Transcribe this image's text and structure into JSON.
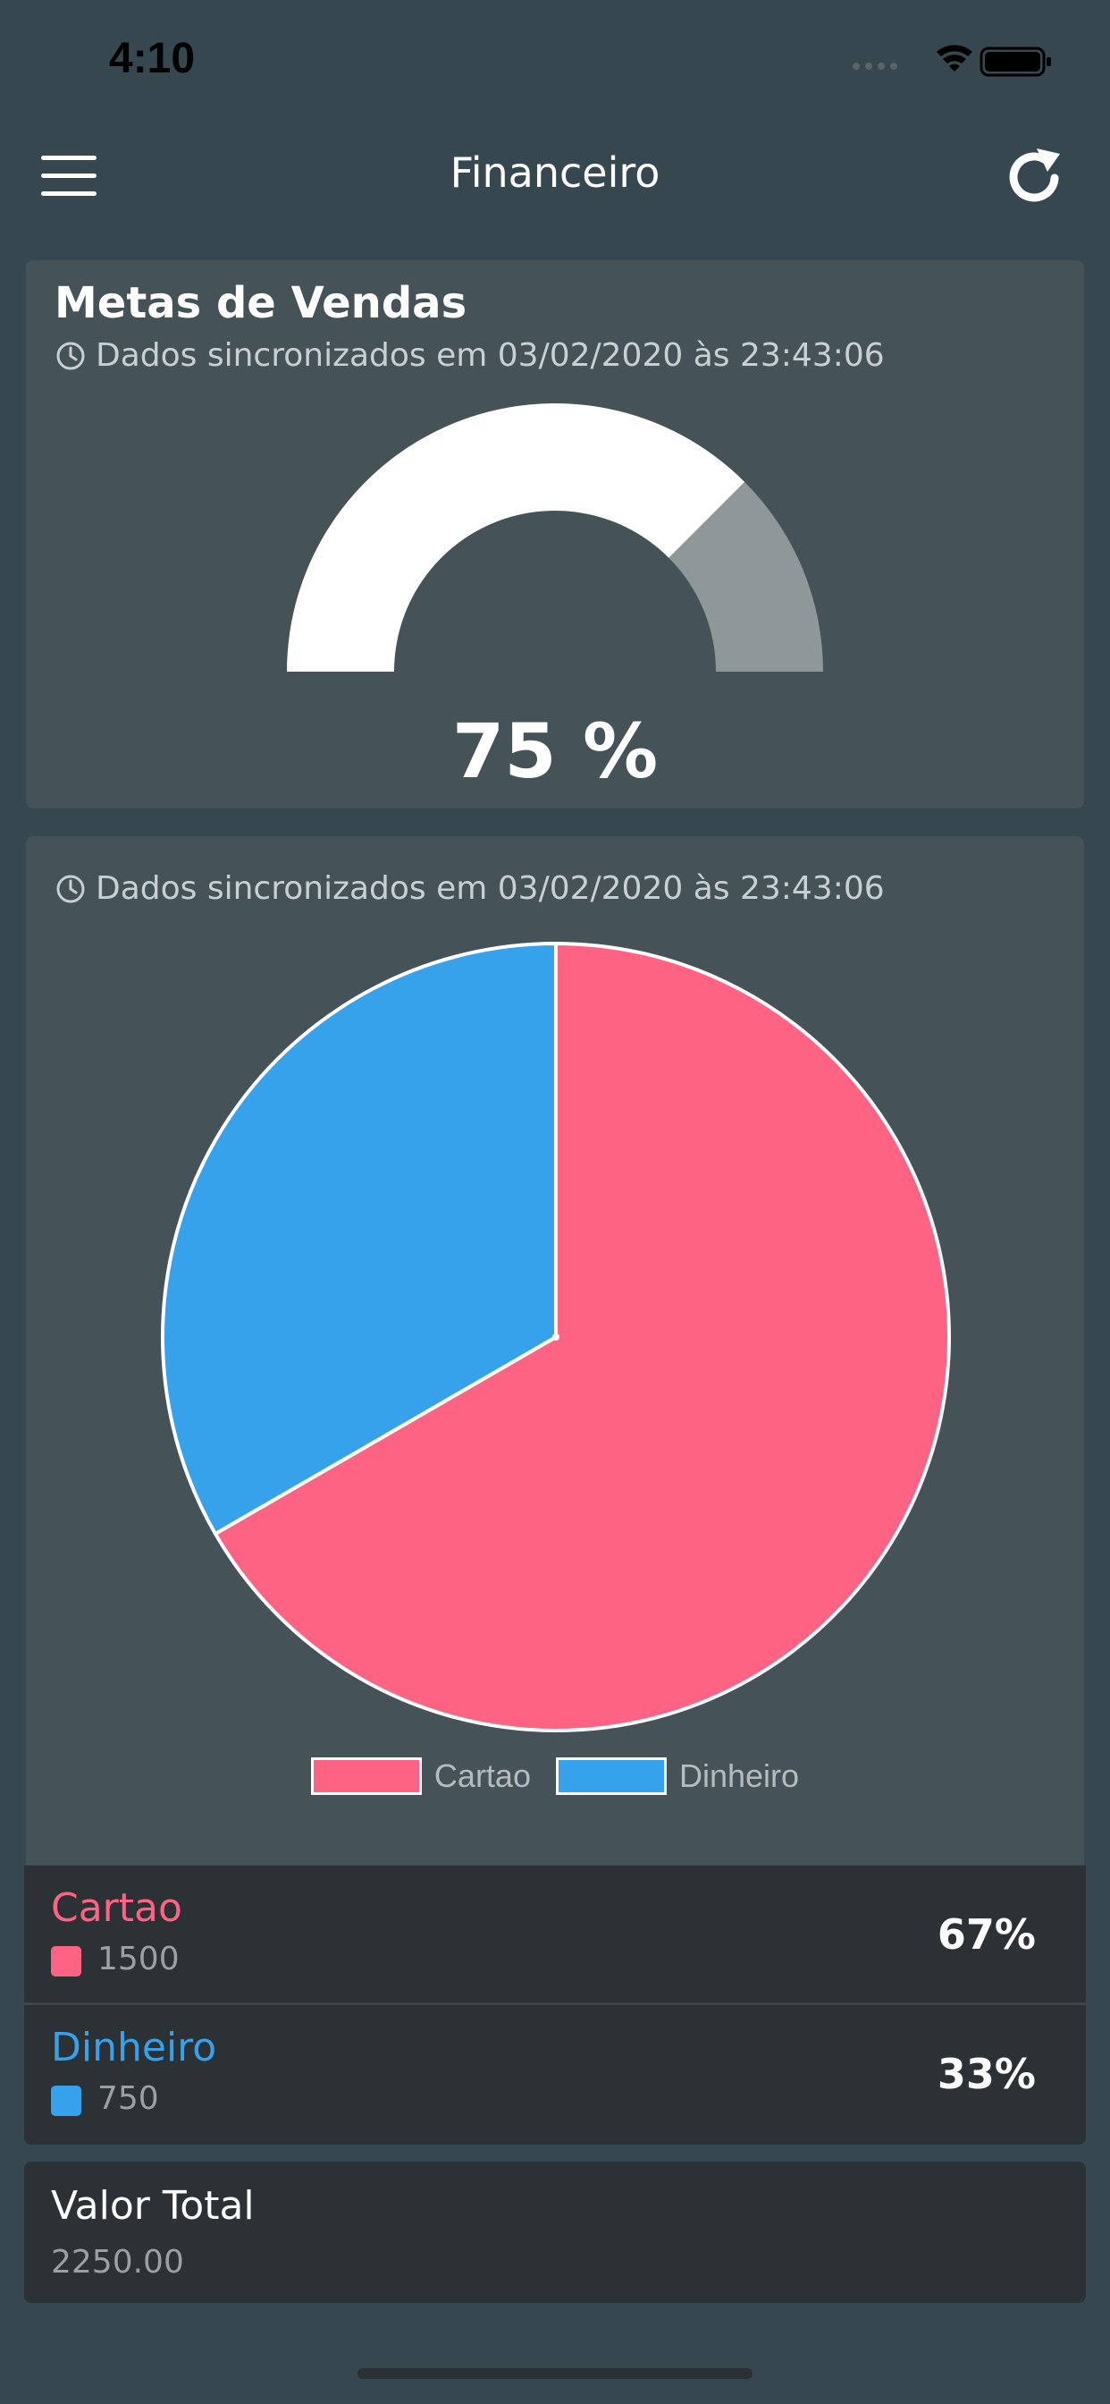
{
  "status_bar": {
    "time": "4:10"
  },
  "nav": {
    "title": "Financeiro"
  },
  "goals_card": {
    "title": "Metas de Vendas",
    "sync_text": "Dados sincronizados em 03/02/2020 às 23:43:06",
    "gauge_percent_value": 75,
    "gauge_label": "75 %"
  },
  "pie_card": {
    "sync_text": "Dados sincronizados em 03/02/2020 às 23:43:06"
  },
  "chart_data": {
    "type": "pie",
    "slices": [
      {
        "label": "Cartao",
        "value": 1500,
        "color": "#ff6384"
      },
      {
        "label": "Dinheiro",
        "value": 750,
        "color": "#36a2eb"
      }
    ],
    "legend": [
      "Cartao",
      "Dinheiro"
    ],
    "legend_position": "bottom"
  },
  "breakdown": [
    {
      "name": "Cartao",
      "value": "1500",
      "percent": "67%",
      "color": "#ff6384"
    },
    {
      "name": "Dinheiro",
      "value": "750",
      "percent": "33%",
      "color": "#36a2eb"
    }
  ],
  "total": {
    "label": "Valor Total",
    "value": "2250.00"
  },
  "colors": {
    "background": "#37474f",
    "card": "#455257",
    "row": "#2b3134",
    "gauge_fill": "#ffffff",
    "gauge_rest": "#8f9799"
  }
}
